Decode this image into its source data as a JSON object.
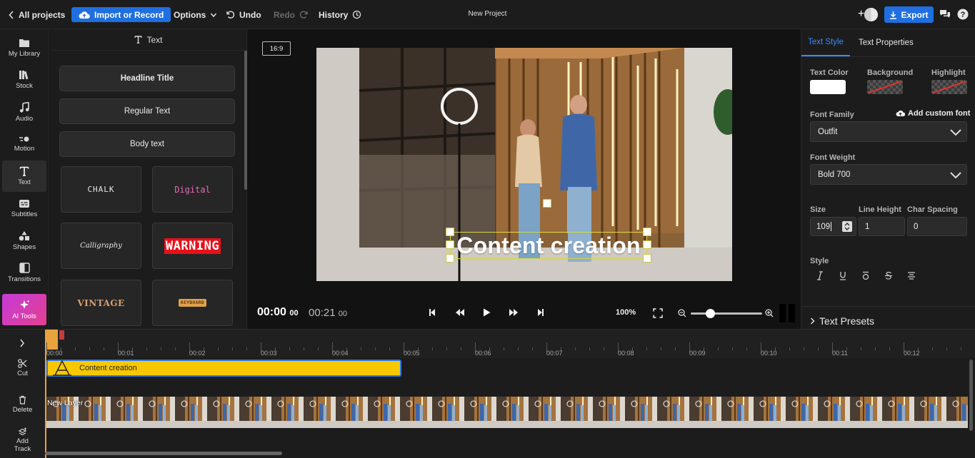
{
  "topbar": {
    "all_projects": "All projects",
    "import_record": "Import or Record",
    "options": "Options",
    "undo": "Undo",
    "redo": "Redo",
    "history": "History",
    "project_title": "New Project",
    "export": "Export"
  },
  "leftnav": {
    "items": [
      {
        "label": "My Library",
        "icon": "folder-icon"
      },
      {
        "label": "Stock",
        "icon": "books-icon"
      },
      {
        "label": "Audio",
        "icon": "music-note-icon"
      },
      {
        "label": "Motion",
        "icon": "motion-icon"
      },
      {
        "label": "Text",
        "icon": "text-icon"
      },
      {
        "label": "Subtitles",
        "icon": "subtitles-icon"
      },
      {
        "label": "Shapes",
        "icon": "shapes-icon"
      },
      {
        "label": "Transitions",
        "icon": "transitions-icon"
      },
      {
        "label": "AI Tools",
        "icon": "sparkle-icon"
      }
    ],
    "active": "Text"
  },
  "text_panel": {
    "header": "Text",
    "buttons": [
      "Headline Title",
      "Regular Text",
      "Body text"
    ],
    "presets": [
      "CHALK",
      "Digital",
      "Calligraphy",
      "WARNING",
      "VINTAGE",
      "KEYBOARD"
    ]
  },
  "preview": {
    "aspect_ratio": "16:9",
    "caption": "Content creation",
    "time_current": "00:00",
    "time_current_frames": "00",
    "time_total": "00:21",
    "time_total_frames": "00",
    "zoom": "100%",
    "zoom_slider_level": 0.27
  },
  "properties": {
    "tabs": [
      "Text Style",
      "Text Properties"
    ],
    "active_tab": "Text Style",
    "text_color_label": "Text Color",
    "background_label": "Background",
    "highlight_label": "Highlight",
    "text_color": "#ffffff",
    "font_family_label": "Font Family",
    "add_custom_font": "Add custom font",
    "font_family": "Outfit",
    "font_weight_label": "Font Weight",
    "font_weight": "Bold 700",
    "size_label": "Size",
    "size": "109",
    "line_height_label": "Line Height",
    "line_height": "1",
    "char_spacing_label": "Char Spacing",
    "char_spacing": "0",
    "style_label": "Style",
    "presets_label": "Text Presets"
  },
  "timeline": {
    "tools": [
      {
        "label": "Cut",
        "icon": "scissors-icon"
      },
      {
        "label": "Delete",
        "icon": "trash-icon"
      },
      {
        "label": "Add Track",
        "icon": "add-track-icon"
      }
    ],
    "ticks": [
      "00:00",
      "00:01",
      "00:02",
      "00:03",
      "00:04",
      "00:05",
      "00:06",
      "00:07",
      "00:08",
      "00:09",
      "00:10",
      "00:11",
      "00:12"
    ],
    "text_clip_label": "Content creation",
    "layer_label": "New Layer"
  },
  "colors": {
    "accent": "#1f6fe0",
    "clip_yellow": "#f7c800",
    "playhead": "#e8a33f"
  }
}
